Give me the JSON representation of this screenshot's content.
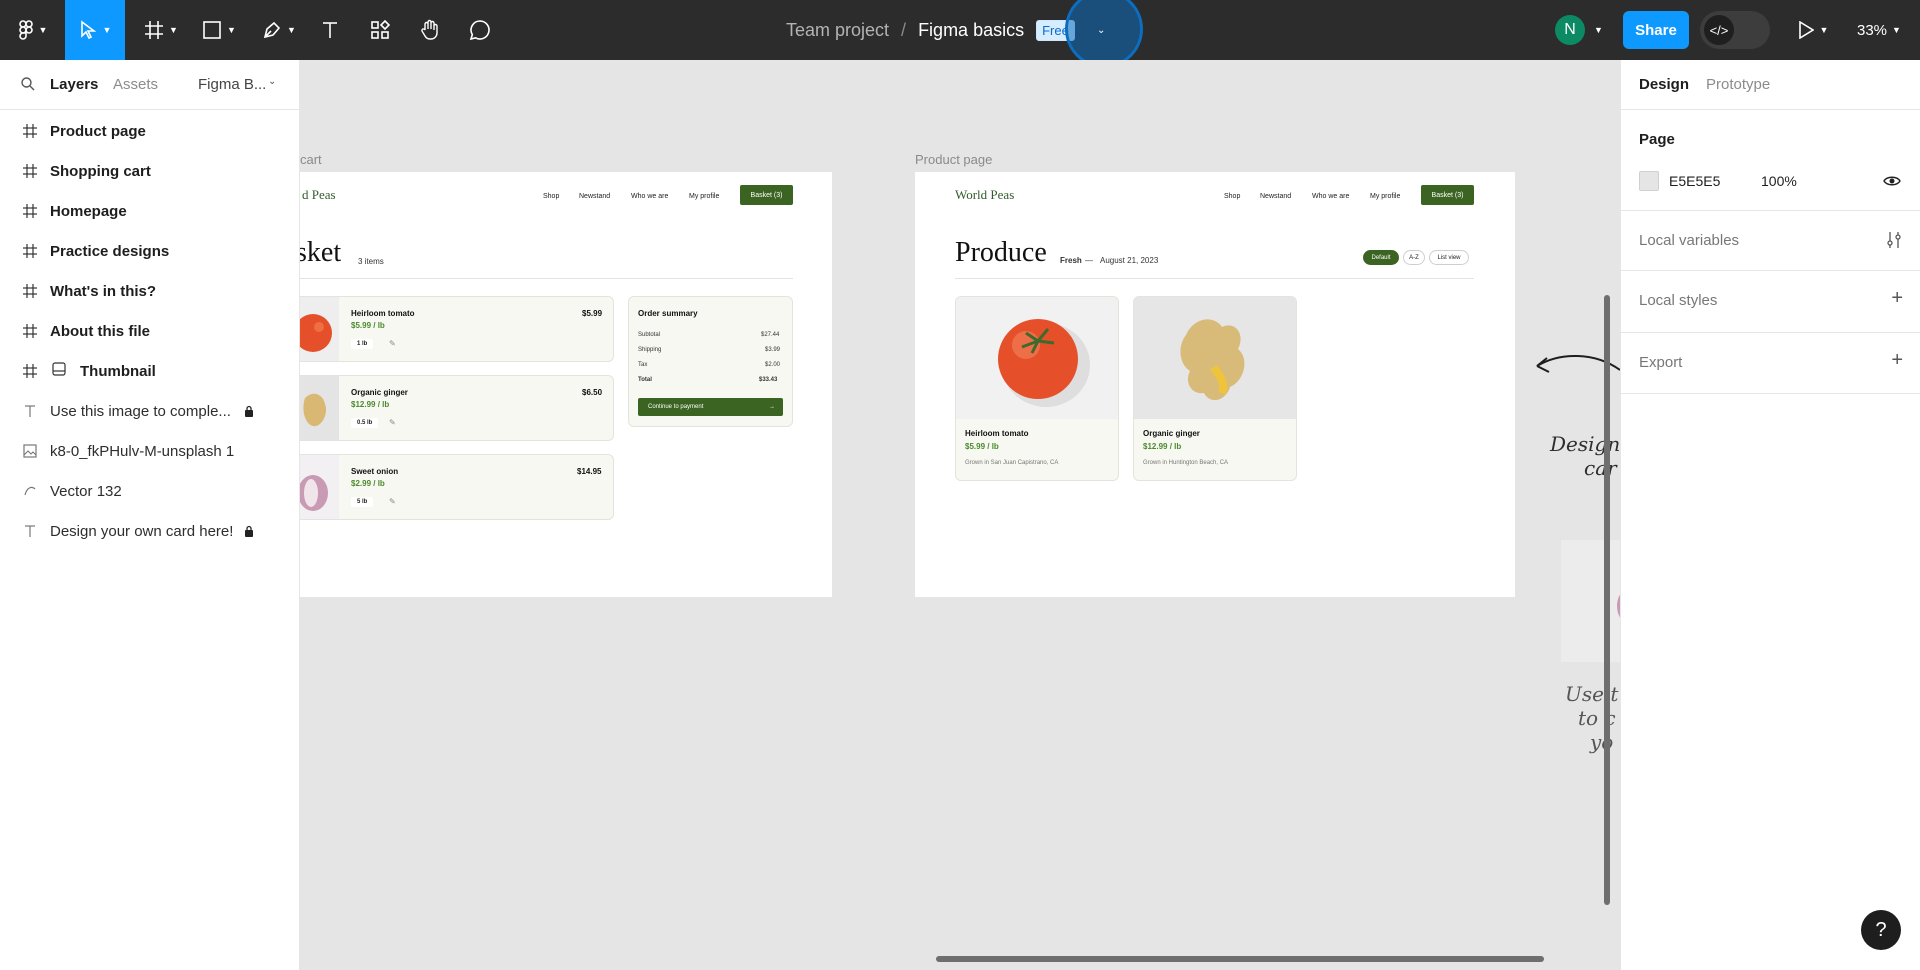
{
  "toolbar": {
    "breadcrumb_team": "Team project",
    "breadcrumb_sep": "/",
    "file_name": "Figma basics",
    "plan_badge": "Free",
    "avatar_initial": "N",
    "share_label": "Share",
    "zoom_level": "33%",
    "accent_color": "#0d99ff"
  },
  "left_panel": {
    "tabs": [
      "Layers",
      "Assets"
    ],
    "page_selector": "Figma B...",
    "layers": [
      {
        "name": "Product page",
        "type": "frame"
      },
      {
        "name": "Shopping cart",
        "type": "frame"
      },
      {
        "name": "Homepage",
        "type": "frame"
      },
      {
        "name": "Practice designs",
        "type": "frame"
      },
      {
        "name": "What's in this?",
        "type": "frame"
      },
      {
        "name": "About this file",
        "type": "frame"
      },
      {
        "name": "Thumbnail",
        "type": "component"
      },
      {
        "name": "Use this image to comple...",
        "type": "text",
        "locked": true
      },
      {
        "name": "k8-0_fkPHulv-M-unsplash 1",
        "type": "image"
      },
      {
        "name": "Vector 132",
        "type": "vector"
      },
      {
        "name": "Design your own card here!",
        "type": "text",
        "locked": true
      }
    ]
  },
  "canvas": {
    "cart_label": "cart",
    "product_label": "Product page",
    "cart": {
      "logo": "d Peas",
      "nav": [
        "Shop",
        "Newstand",
        "Who we are",
        "My profile"
      ],
      "basket_btn": "Basket (3)",
      "title": "sket",
      "item_count": "3 items",
      "items": [
        {
          "name": "Heirloom tomato",
          "unit_price": "$5.99 / lb",
          "total": "$5.99",
          "qty": "1 lb"
        },
        {
          "name": "Organic ginger",
          "unit_price": "$12.99 / lb",
          "total": "$6.50",
          "qty": "0.5 lb"
        },
        {
          "name": "Sweet onion",
          "unit_price": "$2.99 / lb",
          "total": "$14.95",
          "qty": "5 lb"
        }
      ],
      "summary": {
        "title": "Order summary",
        "rows": [
          {
            "label": "Subtotal",
            "value": "$27.44"
          },
          {
            "label": "Shipping",
            "value": "$3.99"
          },
          {
            "label": "Tax",
            "value": "$2.00"
          },
          {
            "label": "Total",
            "value": "$33.43"
          }
        ],
        "pay_btn": "Continue to payment"
      }
    },
    "product": {
      "logo": "World Peas",
      "nav": [
        "Shop",
        "Newstand",
        "Who we are",
        "My profile"
      ],
      "basket_btn": "Basket (3)",
      "title": "Produce",
      "tag": "Fresh",
      "dash": "—",
      "date": "August 21, 2023",
      "sorts": [
        "Default",
        "A-Z",
        "List view"
      ],
      "cards": [
        {
          "name": "Heirloom tomato",
          "price": "$5.99 / lb",
          "origin": "Grown in San Juan Capistrano, CA"
        },
        {
          "name": "Organic ginger",
          "price": "$12.99 / lb",
          "origin": "Grown in Huntington Beach, CA"
        }
      ]
    },
    "handwriting_1a": "Design",
    "handwriting_1b": "car",
    "handwriting_2a": "Use t",
    "handwriting_2b": "to c",
    "handwriting_2c": "yo"
  },
  "right_panel": {
    "tabs": [
      "Design",
      "Prototype"
    ],
    "page_title": "Page",
    "page_color": "E5E5E5",
    "page_opacity": "100%",
    "local_variables": "Local variables",
    "local_styles": "Local styles",
    "export": "Export"
  },
  "help_label": "?"
}
